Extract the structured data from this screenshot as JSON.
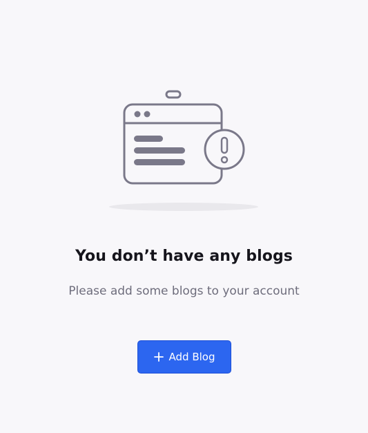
{
  "empty_state": {
    "illustration_icon": "browser-window-warning-icon",
    "title": "You don’t have any blogs",
    "subtitle": "Please add some blogs to your account",
    "add_button": {
      "icon": "plus-icon",
      "label": "Add Blog"
    }
  },
  "colors": {
    "background": "#f8f7fa",
    "illustration_stroke": "#7a7889",
    "title_text": "#16151c",
    "subtitle_text": "#6e6d7c",
    "primary_button": "#2c66f0",
    "primary_button_text": "#ffffff"
  }
}
